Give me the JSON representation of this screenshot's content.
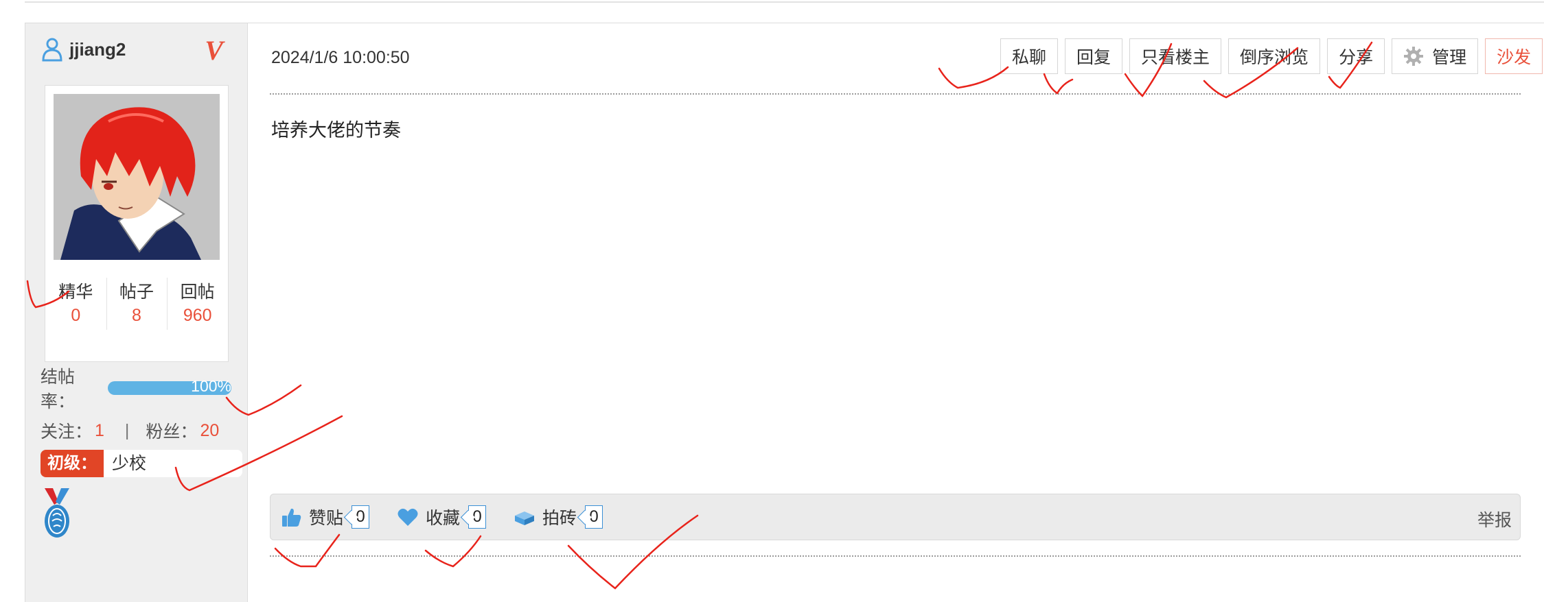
{
  "user": {
    "username": "jjiang2",
    "vip_mark": "V",
    "stats": [
      {
        "label": "精华",
        "value": "0"
      },
      {
        "label": "帖子",
        "value": "8"
      },
      {
        "label": "回帖",
        "value": "960"
      }
    ],
    "completion_rate_label": "结帖率：",
    "completion_rate_value": "100%",
    "completion_rate_fraction": 1.0,
    "follow_label": "关注：",
    "follow_count": "1",
    "separator": "|",
    "fans_label": "粉丝：",
    "fans_count": "20",
    "rank_badge": "初级：",
    "rank_name": "少校",
    "medal_icon": "medal-icon"
  },
  "post": {
    "date": "2024/1/6 10:00:50",
    "body": "培养大佬的节奏",
    "actions": {
      "private_message": "私聊",
      "reply": "回复",
      "only_author": "只看楼主",
      "reverse_order": "倒序浏览",
      "share": "分享",
      "manage": "管理",
      "sofa": "沙发"
    },
    "feedback": {
      "like_label": "赞贴",
      "like_count": "0",
      "favorite_label": "收藏",
      "favorite_count": "0",
      "brick_label": "拍砖",
      "brick_count": "0",
      "report": "举报"
    }
  },
  "colors": {
    "accent_red": "#e9503a",
    "badge_red": "#e14526",
    "progress_blue": "#5fb3e4",
    "icon_blue": "#4a9fe0",
    "annotation_red": "#e8231b"
  }
}
